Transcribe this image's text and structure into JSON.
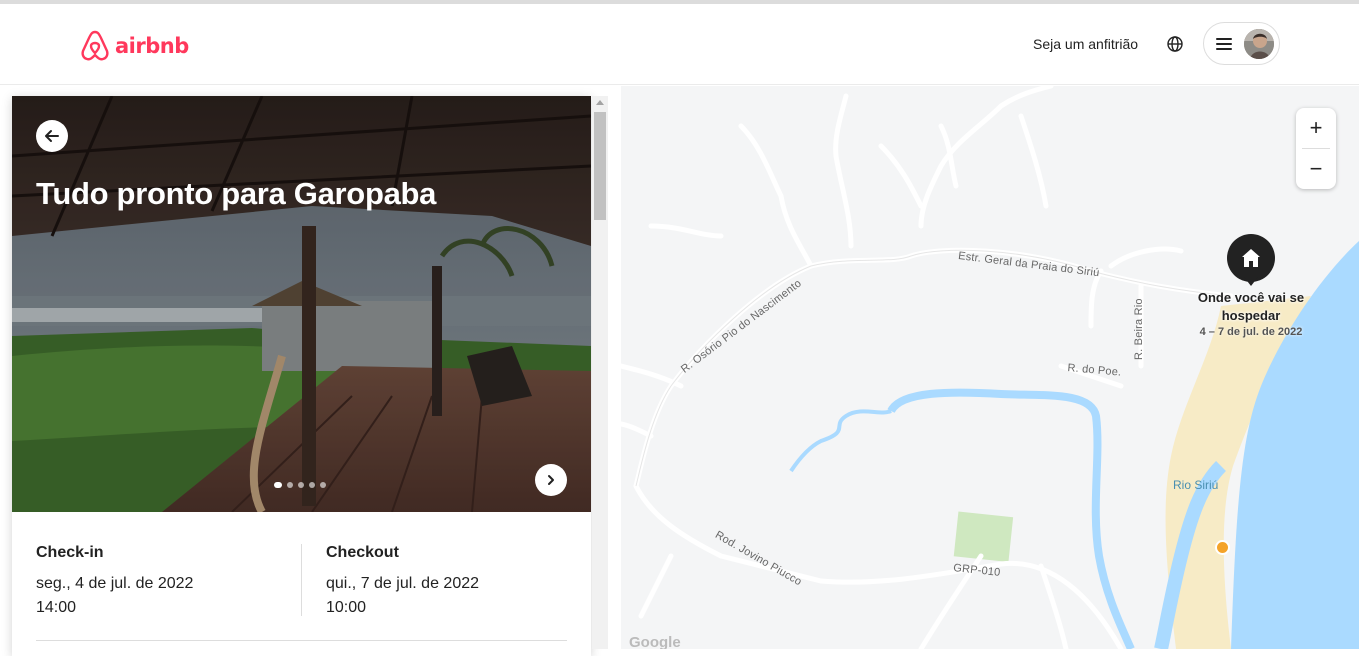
{
  "header": {
    "brand": "airbnb",
    "host_link": "Seja um anfitrião",
    "globe_icon": "globe-icon",
    "menu_icon": "hamburger-menu-icon",
    "avatar": "user-avatar"
  },
  "hero": {
    "title": "Tudo pronto para Garopaba",
    "photo_count": 5,
    "active_photo": 1
  },
  "checkin": {
    "label": "Check-in",
    "date": "seg., 4 de jul. de 2022",
    "time": "14:00"
  },
  "checkout": {
    "label": "Checkout",
    "date": "qui., 7 de jul. de 2022",
    "time": "10:00"
  },
  "map": {
    "zoom_in": "+",
    "zoom_out": "−",
    "pin_label": "Onde você vai se hospedar",
    "pin_dates": "4 – 7 de jul. de 2022",
    "streets": {
      "estrada": "Estr. Geral da Praia do Siriú",
      "osorio": "R. Osório Pio do Nascimento",
      "beira_rio": "R. Beira Rio",
      "do_poe": "R. do Poe.",
      "jovino": "Rod. Jovino Piucco",
      "grp": "GRP-010"
    },
    "river": "Rio Siriú",
    "attribution": "Google"
  },
  "colors": {
    "brand": "#ff385c",
    "water": "#aadaff",
    "sand": "#f7ebc6",
    "park": "#cfe8c0"
  }
}
